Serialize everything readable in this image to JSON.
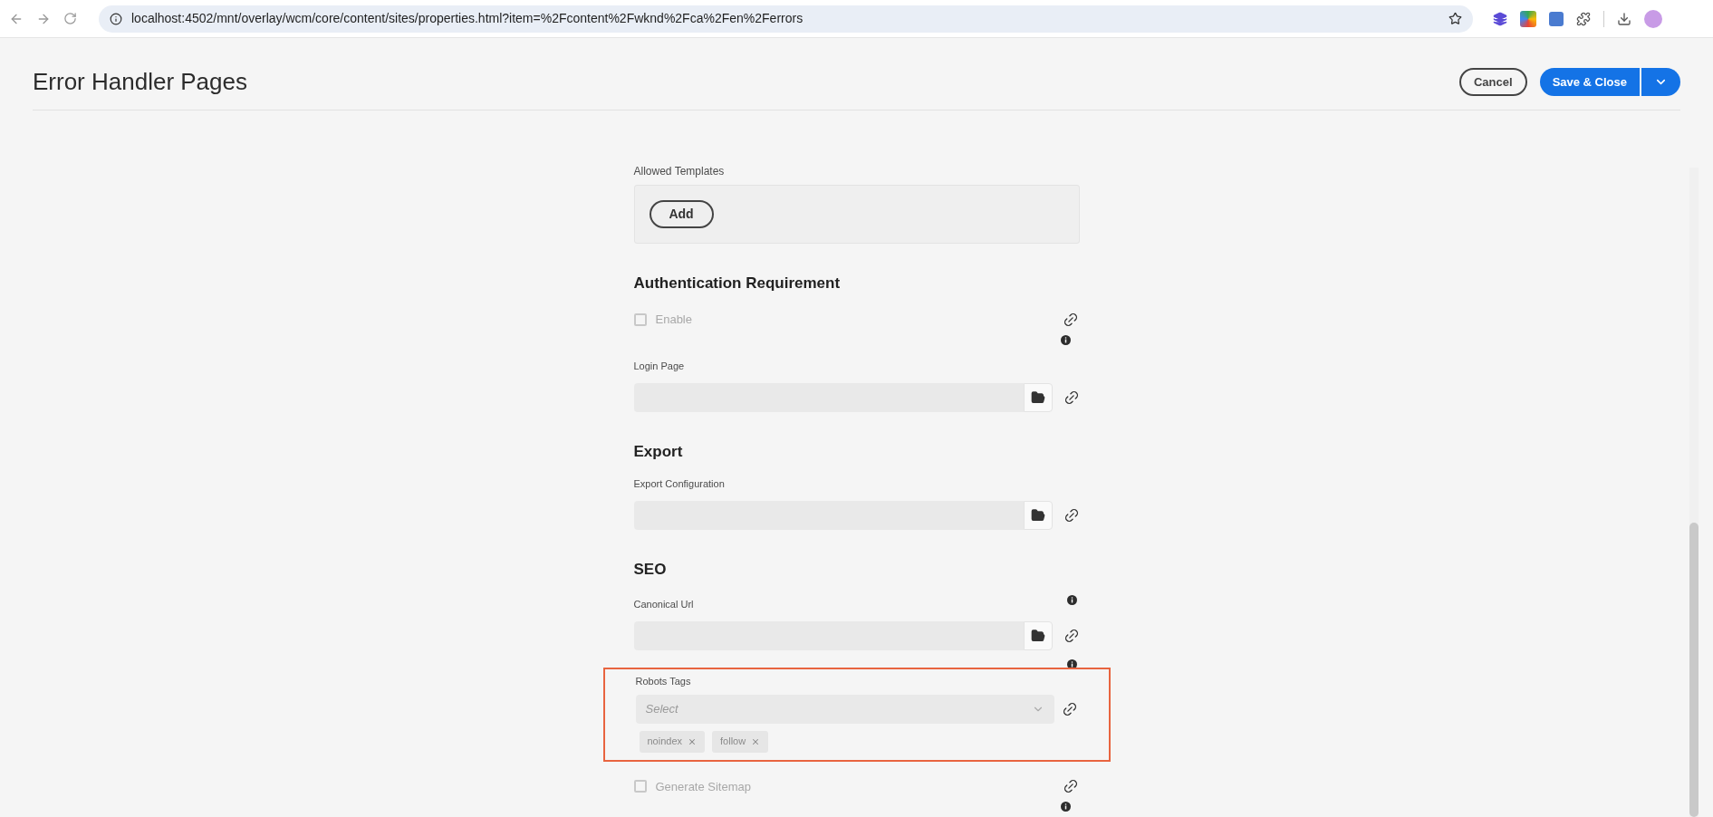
{
  "browser": {
    "url": "localhost:4502/mnt/overlay/wcm/core/content/sites/properties.html?item=%2Fcontent%2Fwknd%2Fca%2Fen%2Ferrors"
  },
  "header": {
    "title": "Error Handler Pages",
    "buttons": [
      {
        "label": "Cancel",
        "kind": "secondary"
      },
      {
        "label": "Save & Close",
        "kind": "primary"
      }
    ]
  },
  "form": [
    {
      "kind": "multifield",
      "label": "Allowed Templates",
      "button": "Add"
    },
    {
      "kind": "heading",
      "text": "Authentication Requirement"
    },
    {
      "kind": "checkbox",
      "label": "Enable",
      "checked": false,
      "disabled": true,
      "info_icon": true
    },
    {
      "kind": "path",
      "label": "Login Page",
      "info_icon": false
    },
    {
      "kind": "heading",
      "text": "Export"
    },
    {
      "kind": "path",
      "label": "Export Configuration",
      "info_icon": false
    },
    {
      "kind": "heading",
      "text": "SEO"
    },
    {
      "kind": "path",
      "label": "Canonical Url",
      "info_icon": true
    },
    {
      "kind": "tags",
      "label": "Robots Tags",
      "placeholder": "Select",
      "info_icon": true,
      "highlighted": true,
      "tags": [
        "noindex",
        "follow"
      ]
    },
    {
      "kind": "checkbox",
      "label": "Generate Sitemap",
      "checked": false,
      "disabled": true,
      "info_icon": true
    }
  ]
}
